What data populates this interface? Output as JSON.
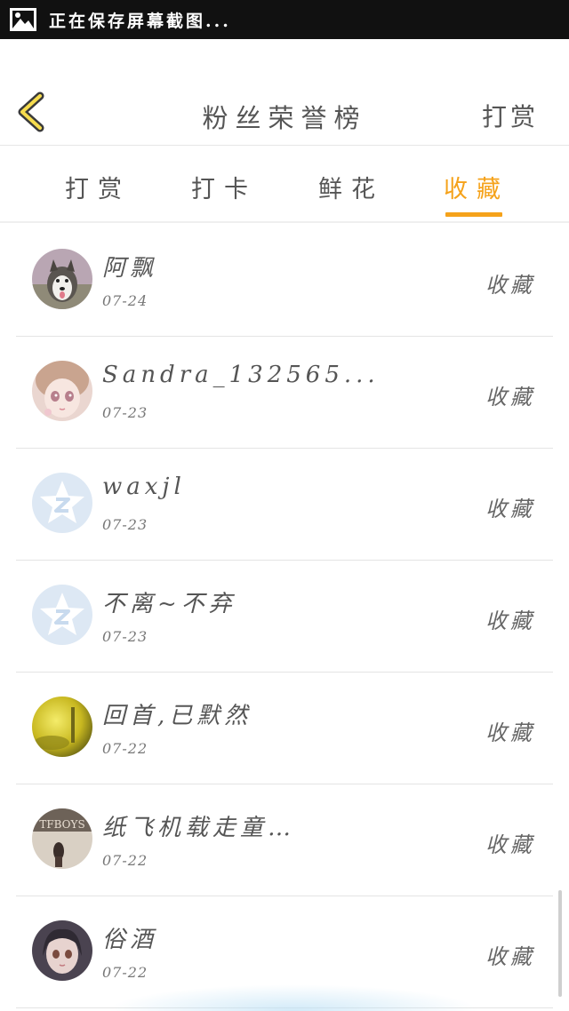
{
  "status_bar": {
    "text": "正在保存屏幕截图..."
  },
  "header": {
    "title": "粉丝荣誉榜",
    "action_label": "打赏"
  },
  "tabs": [
    {
      "label": "打赏",
      "active": false
    },
    {
      "label": "打卡",
      "active": false
    },
    {
      "label": "鲜花",
      "active": false
    },
    {
      "label": "收藏",
      "active": true
    }
  ],
  "accent_color": "#f5a21a",
  "fans": [
    {
      "name": "阿飘",
      "date": "07-24",
      "action": "收藏",
      "avatar": "husky-dog-avatar"
    },
    {
      "name": "Sandra_132565...",
      "date": "07-23",
      "action": "收藏",
      "avatar": "anime-girl-avatar"
    },
    {
      "name": "waxjl",
      "date": "07-23",
      "action": "收藏",
      "avatar": "default-qq-avatar"
    },
    {
      "name": "不离~不弃",
      "date": "07-23",
      "action": "收藏",
      "avatar": "default-qq-avatar"
    },
    {
      "name": "回首,已默然",
      "date": "07-22",
      "action": "收藏",
      "avatar": "yellow-landscape-avatar"
    },
    {
      "name": "纸飞机载走童…",
      "date": "07-22",
      "action": "收藏",
      "avatar": "tfboys-avatar"
    },
    {
      "name": "俗酒",
      "date": "07-22",
      "action": "收藏",
      "avatar": "doll-avatar"
    }
  ]
}
